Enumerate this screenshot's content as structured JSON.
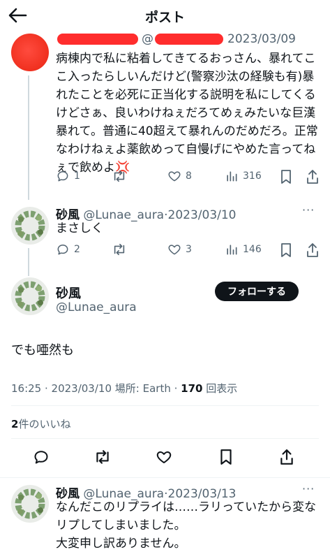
{
  "header": {
    "title": "ポスト"
  },
  "tweet1": {
    "date": "2023/03/09",
    "text": "病棟内で私に粘着してきてるおっさん、暴れてここ入ったらしいんだけど(警察沙汰の経験も有)暴れたことを必死に正当化する説明を私にしてくるけどさぁ、良いわけねぇだろてめぇみたいな巨漢暴れて。普通に40超えて暴れんのだめだろ。正常なわけねぇよ薬飲めって自慢げにやめた言ってねぇで飲めよ💢",
    "replies": "1",
    "reposts": "",
    "likes": "8",
    "views": "316"
  },
  "tweet2": {
    "name": "砂風",
    "handle": "@Lunae_aura",
    "date": "2023/03/10",
    "text": "まさしく",
    "replies": "2",
    "reposts": "",
    "likes": "3",
    "views": "146"
  },
  "main_tweet": {
    "name": "砂風",
    "handle": "@Lunae_aura",
    "follow_label": "フォローする",
    "text": "でも唖然も",
    "time": "16:25 · 2023/03/10",
    "location_label": "場所: Earth",
    "views_count": "170",
    "views_label": "回表示",
    "likes_count": "2",
    "likes_label": "件のいいね"
  },
  "tweet3": {
    "name": "砂風",
    "handle": "@Lunae_aura",
    "date": "2023/03/13",
    "text_lines": [
      "なんだこのリプライは……ラリっていたから変な",
      "リプしてしまいました。",
      "大変申し訳ありません。"
    ]
  },
  "colors": {
    "text": "#0f1419",
    "muted": "#536471",
    "redaction": "#ff2d2d",
    "follow_bg": "#0f1419"
  }
}
